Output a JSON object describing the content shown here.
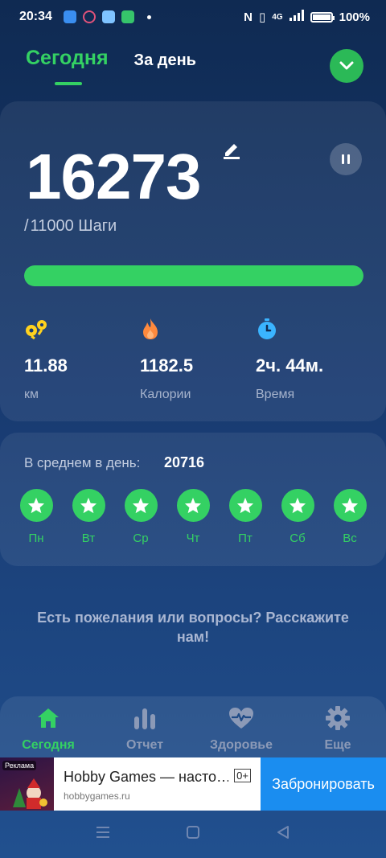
{
  "status_bar": {
    "time": "20:34",
    "battery": "100%",
    "network": "4G"
  },
  "tabs": [
    {
      "label": "Сегодня",
      "active": true
    },
    {
      "label": "За день",
      "active": false
    }
  ],
  "today": {
    "steps": "16273",
    "goal": "11000",
    "goal_unit": "Шаги",
    "progress": 1.0,
    "stats": [
      {
        "icon": "route-pin-icon",
        "value": "11.88",
        "label": "км"
      },
      {
        "icon": "flame-icon",
        "value": "1182.5",
        "label": "Калории"
      },
      {
        "icon": "stopwatch-icon",
        "value": "2ч. 44м.",
        "label": "Время"
      }
    ]
  },
  "average": {
    "label": "В среднем в день:",
    "value": "20716",
    "days": [
      "Пн",
      "Вт",
      "Ср",
      "Чт",
      "Пт",
      "Сб",
      "Вс"
    ]
  },
  "feedback": "Есть пожелания или вопросы? Расскажите нам!",
  "bottom_nav": [
    {
      "icon": "home-icon",
      "label": "Сегодня",
      "active": true
    },
    {
      "icon": "bar-chart-icon",
      "label": "Отчет",
      "active": false
    },
    {
      "icon": "heart-pulse-icon",
      "label": "Здоровье",
      "active": false
    },
    {
      "icon": "gear-icon",
      "label": "Еще",
      "active": false
    }
  ],
  "ad": {
    "tag": "Реклама",
    "title": "Hobby Games — насто…",
    "url": "hobbygames.ru",
    "age": "0+",
    "cta": "Забронировать"
  },
  "colors": {
    "accent": "#34d163",
    "bg_top": "#0f2a52",
    "bg_bottom": "#21508f",
    "flame": "#ff8a3d",
    "route": "#ffd21f",
    "timer": "#3ab4ff",
    "ad_cta": "#1a8df0"
  }
}
